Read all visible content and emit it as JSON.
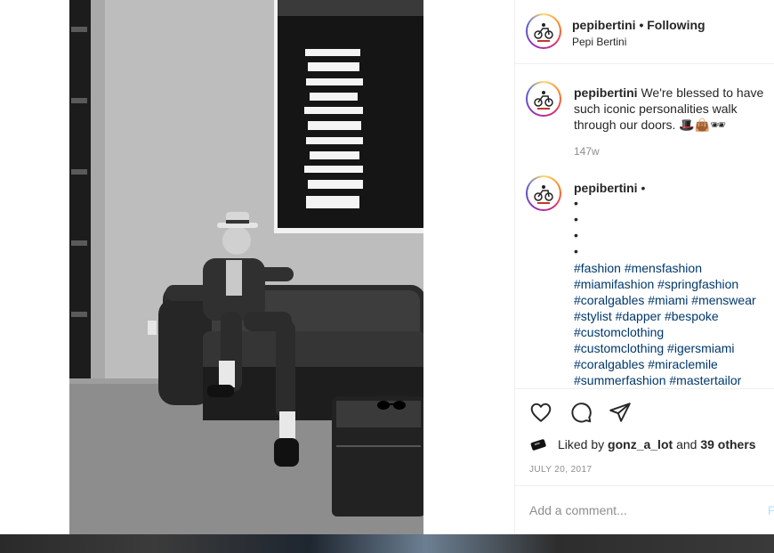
{
  "header": {
    "username": "pepibertini",
    "separator": "•",
    "follow_status": "Following",
    "full_name": "Pepi Bertini"
  },
  "caption": {
    "username": "pepibertini",
    "text": "We're blessed to have such iconic personalities walk through our doors. 🎩👜🕶",
    "time_ago": "147w"
  },
  "comment2": {
    "username": "pepibertini",
    "separator": "•",
    "bullets": [
      "•",
      "•",
      "•",
      "•"
    ],
    "hashtag_lines": [
      "#fashion #mensfashion",
      "#miamifashion #springfashion",
      "#coralgables #miami #menswear",
      "#stylist #dapper #bespoke",
      "#customclothing",
      "#customclothing #igersmiami",
      "#coralgables #miraclemile",
      "#summerfashion #mastertailor"
    ]
  },
  "actions": {
    "like_icon": "heart-icon",
    "comment_icon": "comment-bubble-icon",
    "share_icon": "paper-plane-icon"
  },
  "likes": {
    "prefix": "Liked by",
    "user": "gonz_a_lot",
    "and": "and",
    "others": "39 others"
  },
  "post_date": "JULY 20, 2017",
  "add_comment": {
    "placeholder": "Add a comment...",
    "post_label": "P"
  },
  "colors": {
    "hashtag": "#00376b",
    "muted": "#8e8e8e",
    "text": "#262626",
    "divider": "#efefef"
  }
}
